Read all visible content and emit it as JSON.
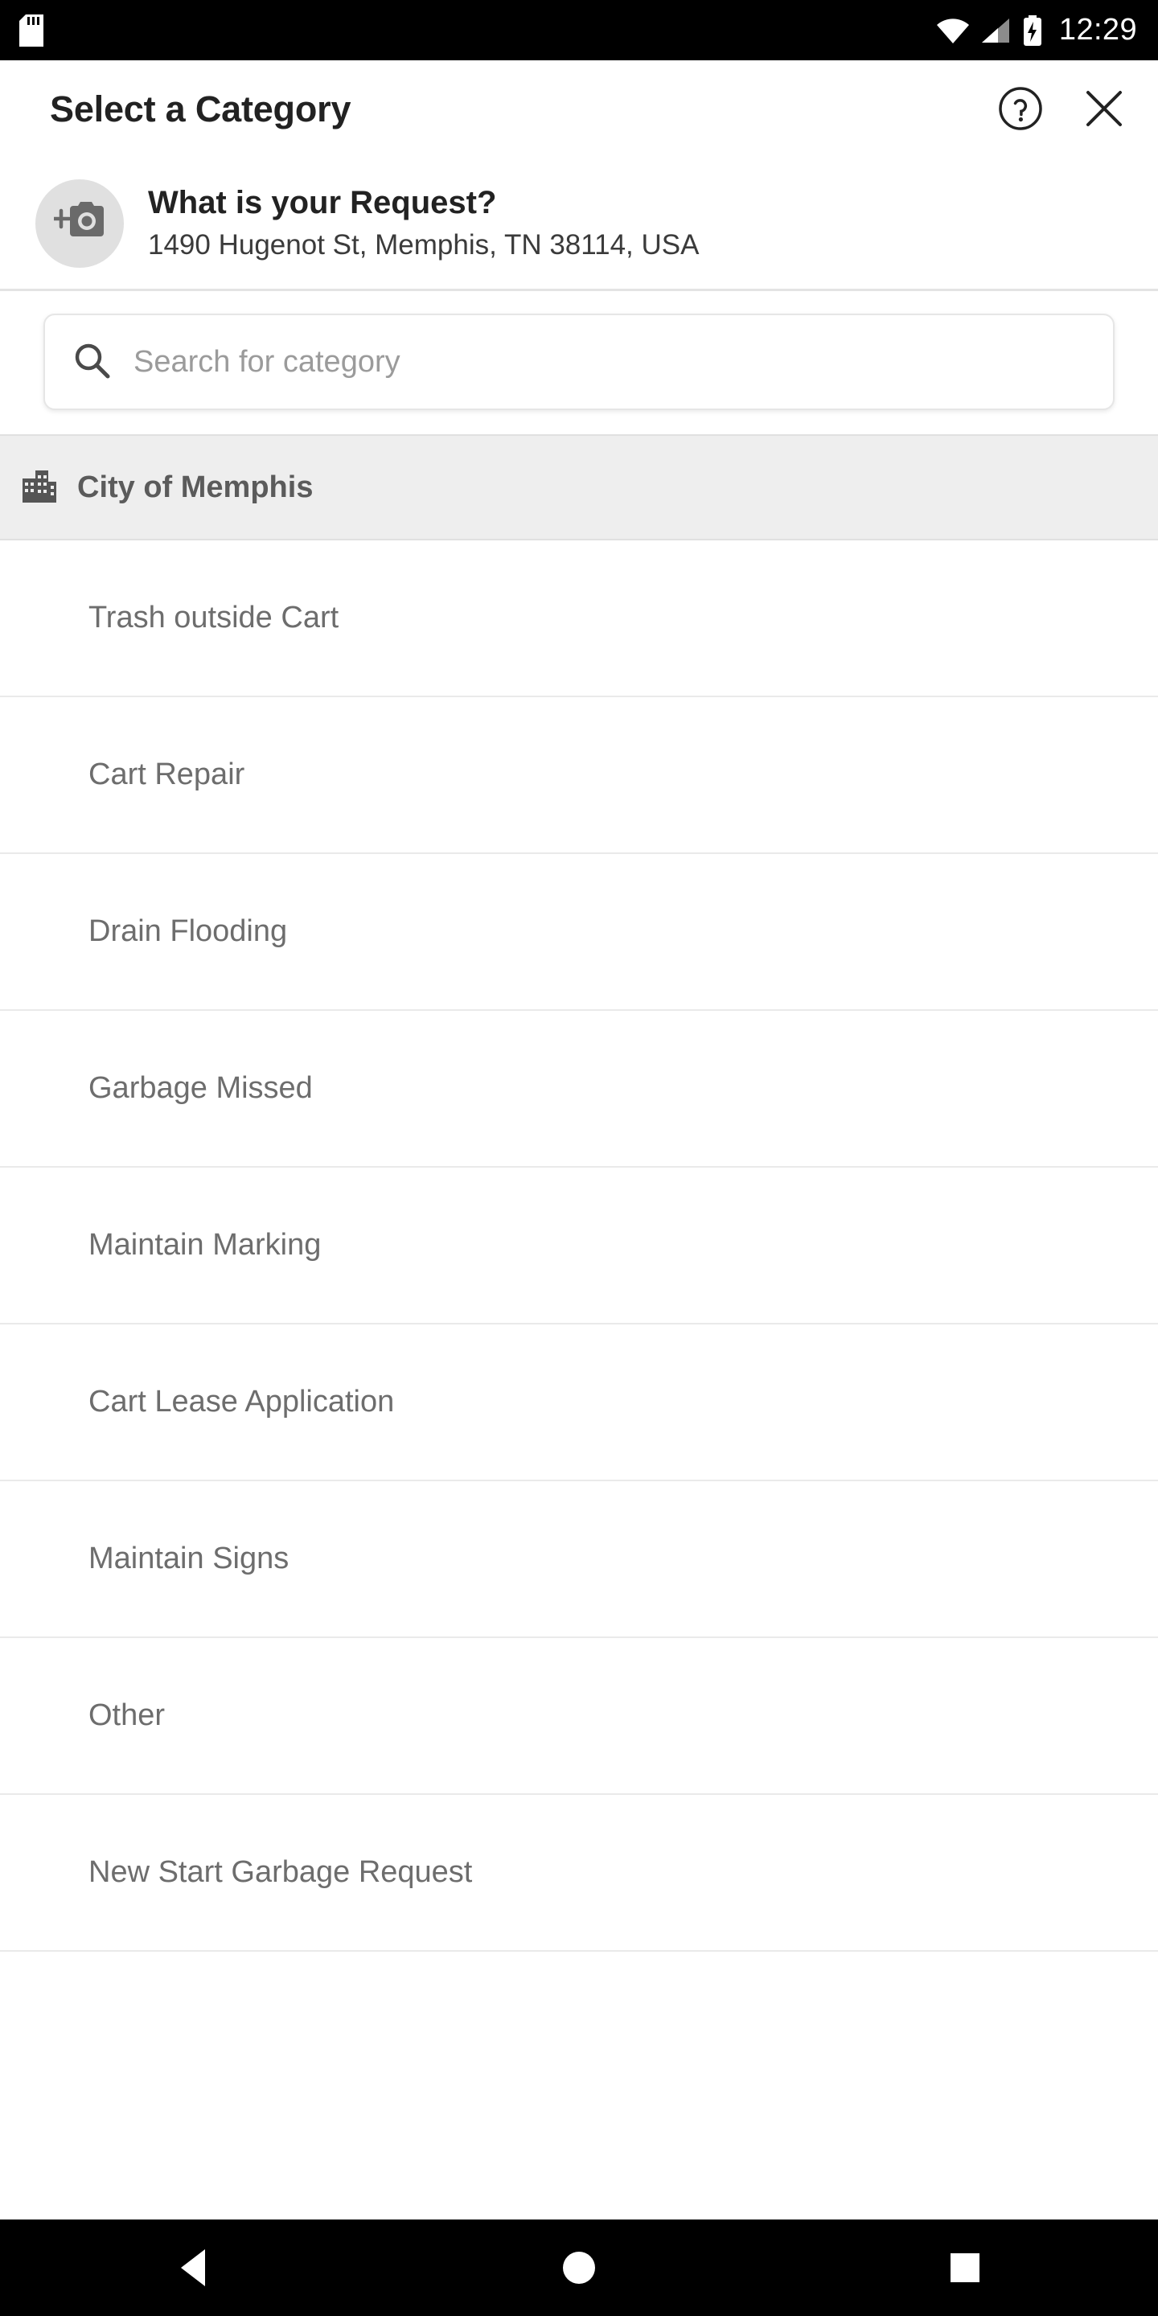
{
  "status_bar": {
    "time": "12:29",
    "icons": [
      "sd-card-icon",
      "wifi-icon",
      "cellular-signal-icon",
      "battery-charging-icon"
    ]
  },
  "header": {
    "title": "Select a Category",
    "help_label": "help-icon",
    "close_label": "close-icon"
  },
  "request": {
    "avatar_icon": "add-photo-icon",
    "title": "What is your Request?",
    "address": "1490 Hugenot St, Memphis, TN 38114, USA"
  },
  "search": {
    "placeholder": "Search for category",
    "value": "",
    "icon": "search-icon"
  },
  "section": {
    "icon": "city-building-icon",
    "label": "City of Memphis"
  },
  "categories": [
    {
      "label": "Trash outside Cart"
    },
    {
      "label": "Cart Repair"
    },
    {
      "label": "Drain Flooding"
    },
    {
      "label": "Garbage Missed"
    },
    {
      "label": "Maintain Marking"
    },
    {
      "label": "Cart Lease Application"
    },
    {
      "label": "Maintain Signs"
    },
    {
      "label": "Other"
    },
    {
      "label": "New Start Garbage Request"
    }
  ],
  "nav_bar": {
    "back": "back-nav-button",
    "home": "home-nav-button",
    "recents": "recents-nav-button"
  },
  "colors": {
    "background": "#ffffff",
    "status_bar": "#000000",
    "section_header": "#eeeeee",
    "text_primary": "#222222",
    "text_secondary": "#6d6d6d"
  }
}
